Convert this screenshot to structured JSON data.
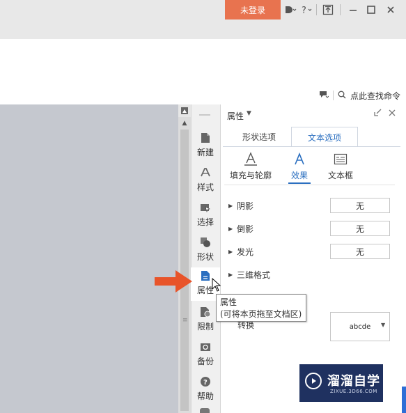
{
  "titlebar": {
    "login_label": "未登录",
    "icons": [
      "skin-icon",
      "help-icon",
      "restore-ribbon-icon",
      "minimize-icon",
      "maximize-icon",
      "close-icon"
    ]
  },
  "search": {
    "label": "点此查找命令"
  },
  "toolbar": {
    "items": [
      {
        "label": "新建",
        "icon": "new-doc-icon"
      },
      {
        "label": "样式",
        "icon": "style-icon"
      },
      {
        "label": "选择",
        "icon": "select-icon"
      },
      {
        "label": "形状",
        "icon": "shape-icon"
      },
      {
        "label": "属性",
        "icon": "property-icon"
      },
      {
        "label": "限制",
        "icon": "restrict-icon"
      },
      {
        "label": "备份",
        "icon": "backup-icon"
      },
      {
        "label": "帮助",
        "icon": "help-icon"
      }
    ]
  },
  "panel": {
    "title": "属性",
    "tabs": [
      "形状选项",
      "文本选项"
    ],
    "active_tab": "文本选项",
    "subtabs": [
      {
        "label": "填充与轮廓"
      },
      {
        "label": "效果"
      },
      {
        "label": "文本框"
      }
    ],
    "active_subtab": "效果",
    "rows": [
      {
        "label": "阴影",
        "value": "无"
      },
      {
        "label": "倒影",
        "value": "无"
      },
      {
        "label": "发光",
        "value": "无"
      },
      {
        "label": "三维格式",
        "value": ""
      }
    ],
    "transform": {
      "label": "转换",
      "value": "abcde"
    }
  },
  "tooltip": {
    "title": "属性",
    "desc": "(可将本页拖至文档区)"
  },
  "watermark": {
    "name": "溜溜自学",
    "url": "ZIXUE.3D66.COM"
  },
  "colors": {
    "accent": "#2b6fc0",
    "login": "#e8734f",
    "arrow": "#e8542a",
    "watermark_bg": "#1f3160"
  }
}
